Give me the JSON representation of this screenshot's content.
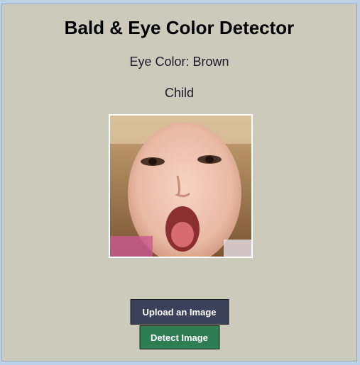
{
  "app": {
    "title": "Bald & Eye Color Detector"
  },
  "results": {
    "eye_color_text": "Eye Color: Brown",
    "age_group_text": "Child"
  },
  "buttons": {
    "upload_label": "Upload an Image",
    "detect_label": "Detect Image"
  },
  "colors": {
    "window_background": "#cccbbb",
    "upload_button": "#3a4159",
    "detect_button": "#2f7d52"
  }
}
